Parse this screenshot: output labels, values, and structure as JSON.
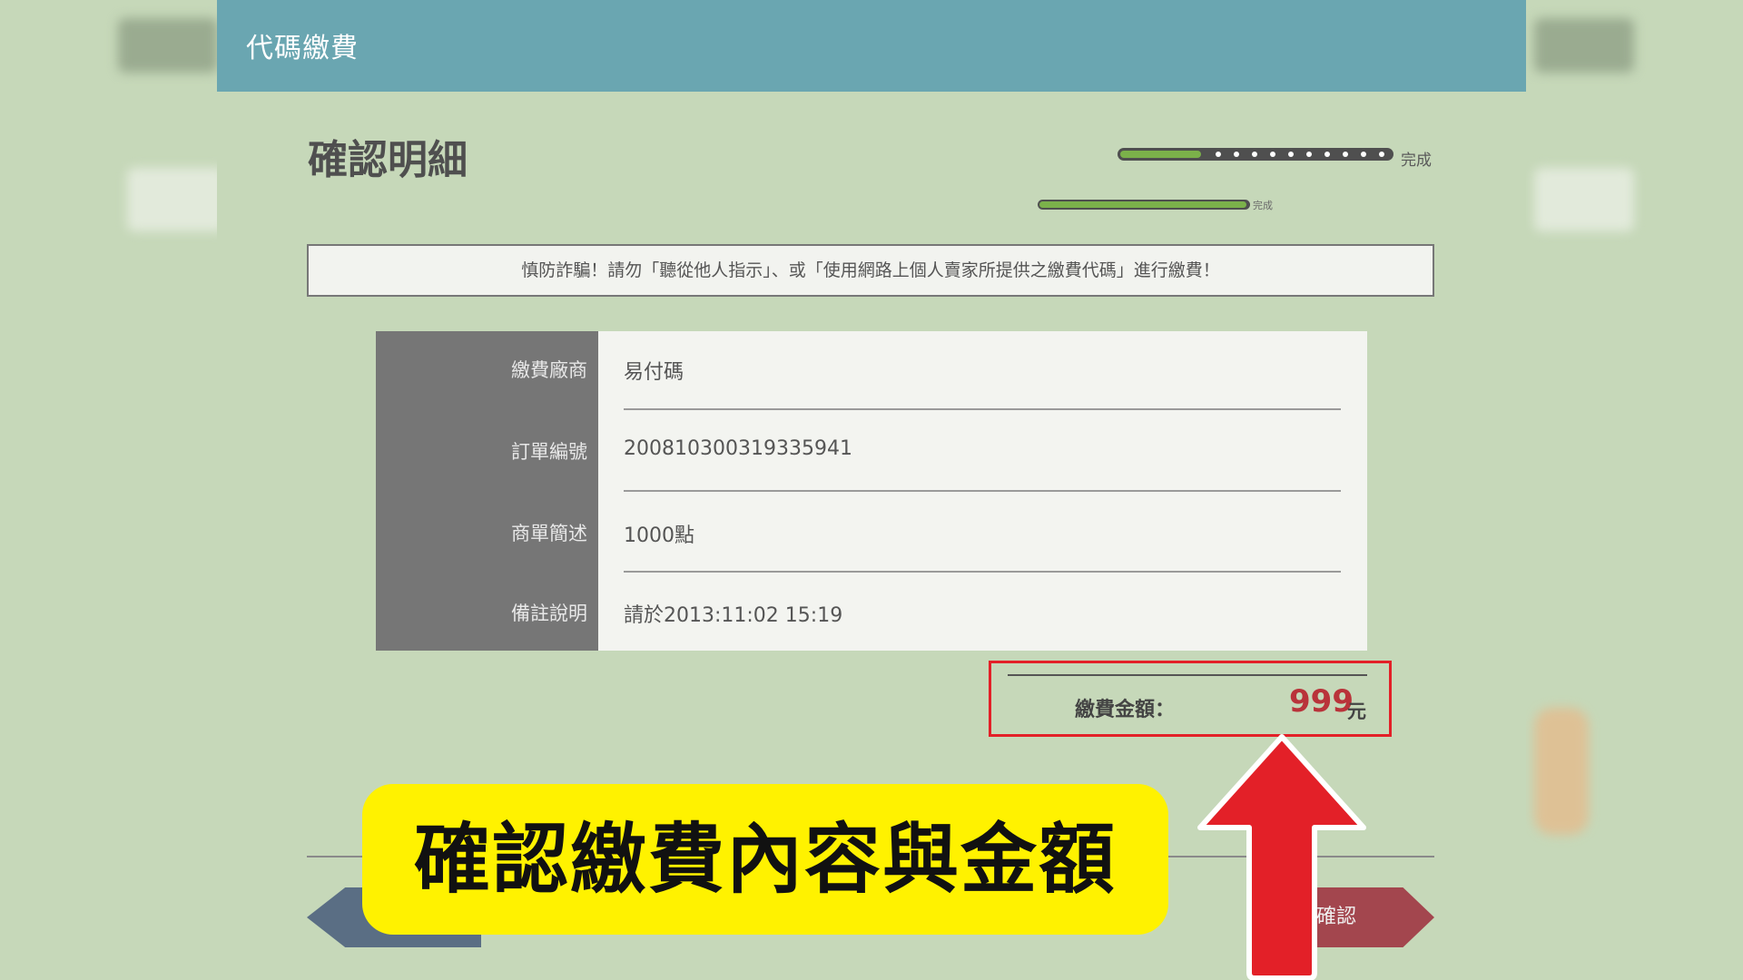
{
  "header": {
    "title": "代碼繳費"
  },
  "page": {
    "title": "確認明細"
  },
  "progress": {
    "main_label": "完成",
    "sub_label": "完成",
    "main_level": 0.3,
    "sub_level": 1.0
  },
  "warning": {
    "text": "慎防詐騙！請勿「聽從他人指示」、或「使用網路上個人賣家所提供之繳費代碼」進行繳費！"
  },
  "details": {
    "rows": [
      {
        "label": "繳費廠商",
        "value": "易付碼"
      },
      {
        "label": "訂單編號",
        "value": "2008103003193359​41"
      },
      {
        "label": "商單簡述",
        "value": "1000點"
      },
      {
        "label": "備註說明",
        "value": "請於2013:11:02 15:19"
      }
    ]
  },
  "amount": {
    "label": "繳費金額：",
    "value": "999",
    "unit": "元"
  },
  "buttons": {
    "confirm_label": "確認"
  },
  "annotation": {
    "text": "確認繳費內容與金額"
  },
  "colors": {
    "header": "#6aa6b1",
    "accent_red": "#e32028",
    "callout": "#fff200",
    "progress": "#7bb14a"
  }
}
